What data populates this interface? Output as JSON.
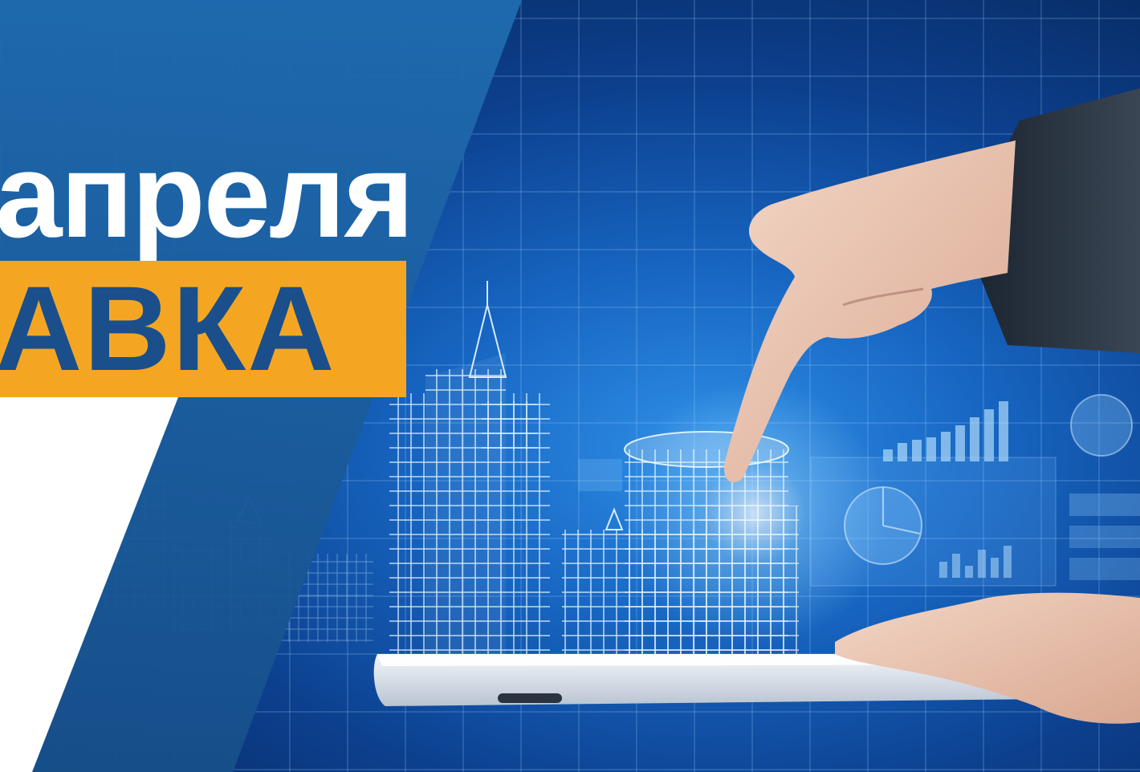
{
  "banner": {
    "date_word": "апреля",
    "label": "АВКА"
  },
  "photo": {
    "description_icon": "city-hologram-on-tablet-photo"
  },
  "colors": {
    "panel_blue": "#1f6bb0",
    "label_bg": "#f4a623",
    "label_text": "#1a4f8c",
    "background_deep": "#06224f"
  }
}
